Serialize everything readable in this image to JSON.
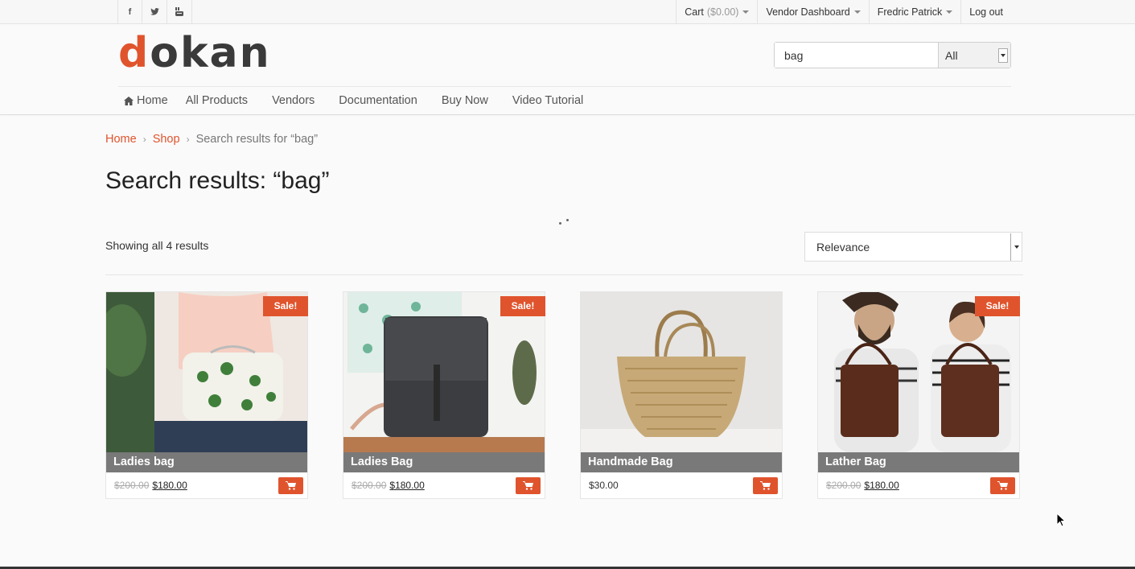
{
  "topbar": {
    "social": [
      {
        "icon": "facebook-icon",
        "glyph": "f"
      },
      {
        "icon": "twitter-icon",
        "glyph": "t"
      },
      {
        "icon": "youtube-icon",
        "glyph": "yt"
      }
    ],
    "cart_label": "Cart",
    "cart_amount": "($0.00)",
    "vendor_dashboard": "Vendor Dashboard",
    "user_name": "Fredric Patrick",
    "logout": "Log out"
  },
  "brand": {
    "logo_first": "d",
    "logo_rest": "okan",
    "accent": "#e0542d"
  },
  "search": {
    "value": "bag",
    "category": "All"
  },
  "nav": {
    "home": "Home",
    "items": [
      "All Products",
      "Vendors",
      "Documentation",
      "Buy Now",
      "Video Tutorial"
    ]
  },
  "breadcrumb": {
    "home": "Home",
    "shop": "Shop",
    "current": "Search results for “bag”"
  },
  "page_title": "Search results: “bag”",
  "result_count": "Showing all 4 results",
  "orderby": {
    "selected": "Relevance"
  },
  "products": [
    {
      "name": "Ladies bag",
      "sale": "Sale!",
      "old_price": "$200.00",
      "price": "$180.00"
    },
    {
      "name": "Ladies Bag",
      "sale": "Sale!",
      "old_price": "$200.00",
      "price": "$180.00"
    },
    {
      "name": "Handmade Bag",
      "sale": "",
      "old_price": "",
      "price": "$30.00"
    },
    {
      "name": "Lather Bag",
      "sale": "Sale!",
      "old_price": "$200.00",
      "price": "$180.00"
    }
  ]
}
